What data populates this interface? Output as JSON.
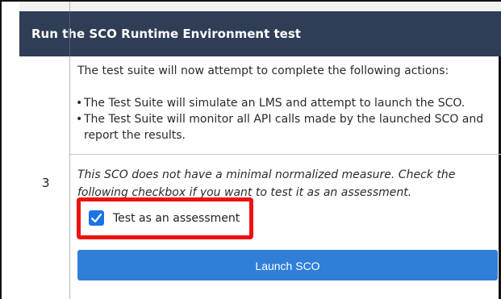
{
  "section": {
    "title": "Run the SCO Runtime Environment test"
  },
  "row": {
    "number": "3",
    "intro": "The test suite will now attempt to complete the following actions:",
    "bullets": [
      "The Test Suite will simulate an LMS and attempt to launch the SCO.",
      "The Test Suite will monitor all API calls made by the launched SCO and report the results."
    ],
    "note": "This SCO does not have a minimal normalized measure. Check the following checkbox if you want to test it as an assessment.",
    "checkbox": {
      "label": "Test as an assessment",
      "checked": true
    },
    "launch_button": "Launch SCO"
  },
  "colors": {
    "header_bg": "#2f3d56",
    "accent_blue": "#2f7fd8",
    "highlight_red": "#ee1111"
  }
}
